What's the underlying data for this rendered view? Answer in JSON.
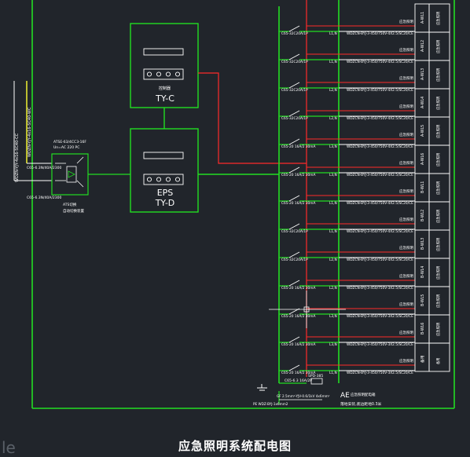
{
  "caption": "应急照明系统配电图",
  "corner_text": "le",
  "colors": {
    "background": "#21252b",
    "bus": "#22dd22",
    "feeder": "#ff2a2a",
    "white": "#ffffff",
    "incoming": "#ffff33"
  },
  "incoming_labels": [
    "WDZN-YJY-4x16-SC40-CC",
    "WDZN-YJY-4x16-SC40-WC"
  ],
  "ats": {
    "spec": "ATSE-63/4CC3-16F",
    "note": "Un=AC 220 PC",
    "breaker_top": "C65-6.3N/40A/2300",
    "breaker_bottom": "C65-6.3N/40A/2300",
    "foot_a": "ATS切换",
    "foot_b": "自动切换装置"
  },
  "units": [
    {
      "label": "TY-C",
      "sub": "控制器"
    },
    {
      "label": "TY-D",
      "sub": "EPS"
    }
  ],
  "circuits": [
    {
      "breaker": "C65-32C20A/1P",
      "phase": "L1,N",
      "cable": "WDZCN-BYJ-3-450/750V-4X2.5/SC20/CE",
      "load": "应急照明",
      "tag": "A-WL1",
      "desc": "应急照明"
    },
    {
      "breaker": "C65-32C20A/1P",
      "phase": "L1,N",
      "cable": "WDZCN-BYJ-3-450/750V-4X2.5/SC20/CE",
      "load": "应急照明",
      "tag": "A-WL2",
      "desc": "应急照明"
    },
    {
      "breaker": "C65-32C20A/1P",
      "phase": "L2,N",
      "cable": "WDZCN-BYJ-3-450/750V-4X2.5/SC20/CE",
      "load": "应急照明",
      "tag": "A-WL3",
      "desc": "应急照明"
    },
    {
      "breaker": "C65-32C20A/1P",
      "phase": "L2,N",
      "cable": "WDZCN-BYJ-3-450/750V-4X2.5/SC20/CE",
      "load": "应急照明",
      "tag": "A-WL4",
      "desc": "应急照明"
    },
    {
      "breaker": "C65-20 16A/2 30mA",
      "phase": "L3,N",
      "cable": "WDZCN-BYJ-3-450/750V-4X2.5/SC20/CE",
      "load": "应急照明",
      "tag": "A-WL5",
      "desc": "应急照明"
    },
    {
      "breaker": "C65-20 16A/2 30mA",
      "phase": "L3,N",
      "cable": "WDZCN-BYJ-3-450/750V-4X2.5/SC20/CE",
      "load": "应急照明",
      "tag": "A-WL6",
      "desc": "应急照明"
    },
    {
      "breaker": "C65-20 16A/2 30mA",
      "phase": "L1,N",
      "cable": "WDZCN-BYJ-3-450/750V-4X2.5/SC20/CE",
      "load": "应急照明",
      "tag": "B-WL1",
      "desc": "应急照明"
    },
    {
      "breaker": "C65-32C20A/1P",
      "phase": "L1,N",
      "cable": "WDZCN-BYJ-3-450/750V-4X2.5/SC20/CE",
      "load": "应急照明",
      "tag": "B-WL2",
      "desc": "应急照明"
    },
    {
      "breaker": "C65-32C20A/1P",
      "phase": "L2,N",
      "cable": "WDZCN-BYJ-3-450/750V-4X2.5/SC20/CE",
      "load": "应急照明",
      "tag": "B-WL3",
      "desc": "应急照明"
    },
    {
      "breaker": "C65-20 16A/2 30mA",
      "phase": "L2,N",
      "cable": "WDZCN-BYJ-3-450/750V-3X2.5/SC20/CE",
      "load": "应急照明",
      "tag": "B-WL4",
      "desc": "应急照明"
    },
    {
      "breaker": "C65-20 16A/2 30mA",
      "phase": "L3,N",
      "cable": "WDZCN-BYJ-3-450/750V-3X2.5/SC20/CE",
      "load": "应急照明",
      "tag": "B-WL5",
      "desc": "应急照明"
    },
    {
      "breaker": "C65-20 16A/2 30mA",
      "phase": "L3,N",
      "cable": "WDZCN-BYJ-3-450/750V-3X2.5/SC20/CE",
      "load": "应急照明",
      "tag": "B-WL6",
      "desc": "应急照明"
    },
    {
      "breaker": "C65-20 16A/2 30mA",
      "phase": "L1,N",
      "cable": "WDZCN-BYJ-3-450/750V-3X2.5/SC20/CE",
      "load": "应急照明",
      "tag": "备用",
      "desc": "备用"
    }
  ],
  "bottom": {
    "breaker": "C65-6.3 16A/2P",
    "spd": "SPD-385",
    "line_a": "GF 2.5mm²-YJV-0.6/1kV 4x6mm²",
    "line_b": "PE WDZ-BYJ-1x6mm2",
    "ae_title": "AE",
    "ae_note1": "应急照明配电箱",
    "ae_note2": "落地安装,底边距地0.3米"
  }
}
